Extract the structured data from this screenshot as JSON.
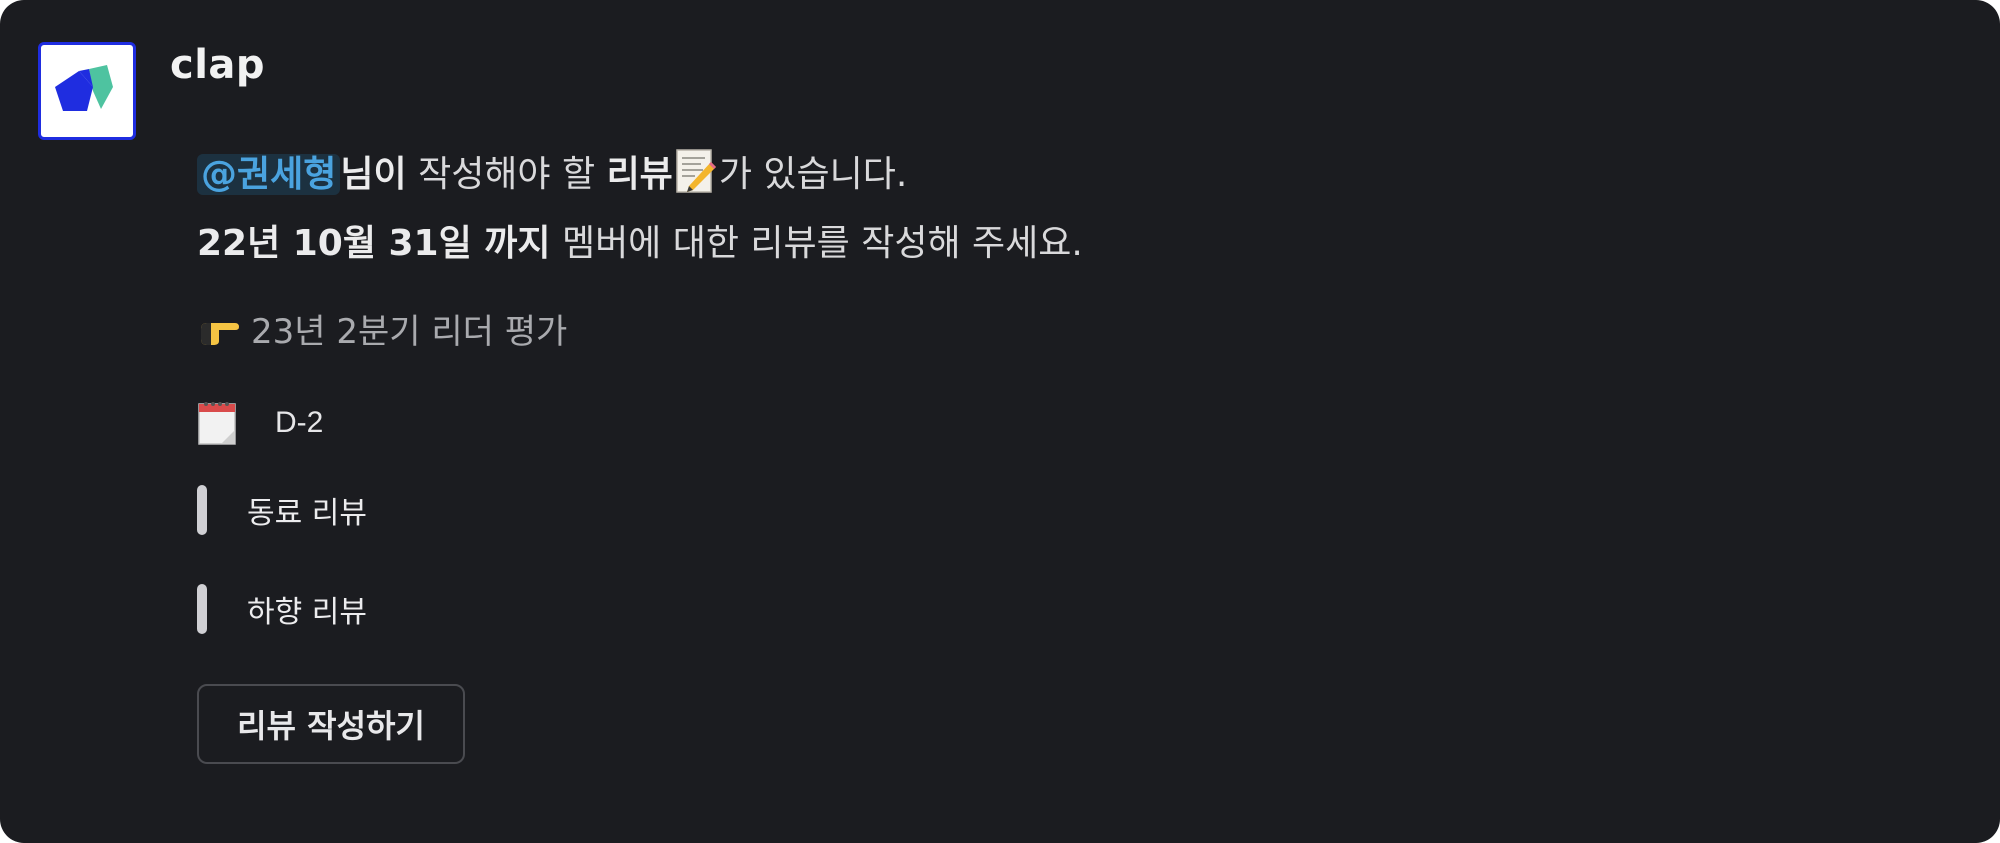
{
  "message": {
    "sender": "clap",
    "line1": {
      "mention": "@권세형",
      "bold_suffix": "님이",
      "text_before_bold": " 작성해야 할 ",
      "bold_review": "리뷰",
      "text_after_emoji": "가 있습니다."
    },
    "line2": {
      "deadline_bold": "22년 10월 31일 까지",
      "text": " 멤버에 대한 리뷰를 작성해 주세요."
    },
    "evaluation_title": "23년 2분기 리더 평가",
    "dday": "D-2",
    "review_types": [
      {
        "label": "동료 리뷰"
      },
      {
        "label": "하향 리뷰"
      }
    ],
    "button_label": "리뷰 작성하기"
  },
  "icons": {
    "avatar": "clap-logo-icon",
    "memo": "memo-emoji-icon",
    "pointer": "pointing-right-emoji-icon",
    "calendar": "calendar-emoji-icon"
  },
  "colors": {
    "background": "#1b1c20",
    "mention_text": "#4aa3df",
    "mention_bg": "#1c3140",
    "logo_blue": "#1f2de0",
    "logo_teal": "#4ec3a0"
  }
}
